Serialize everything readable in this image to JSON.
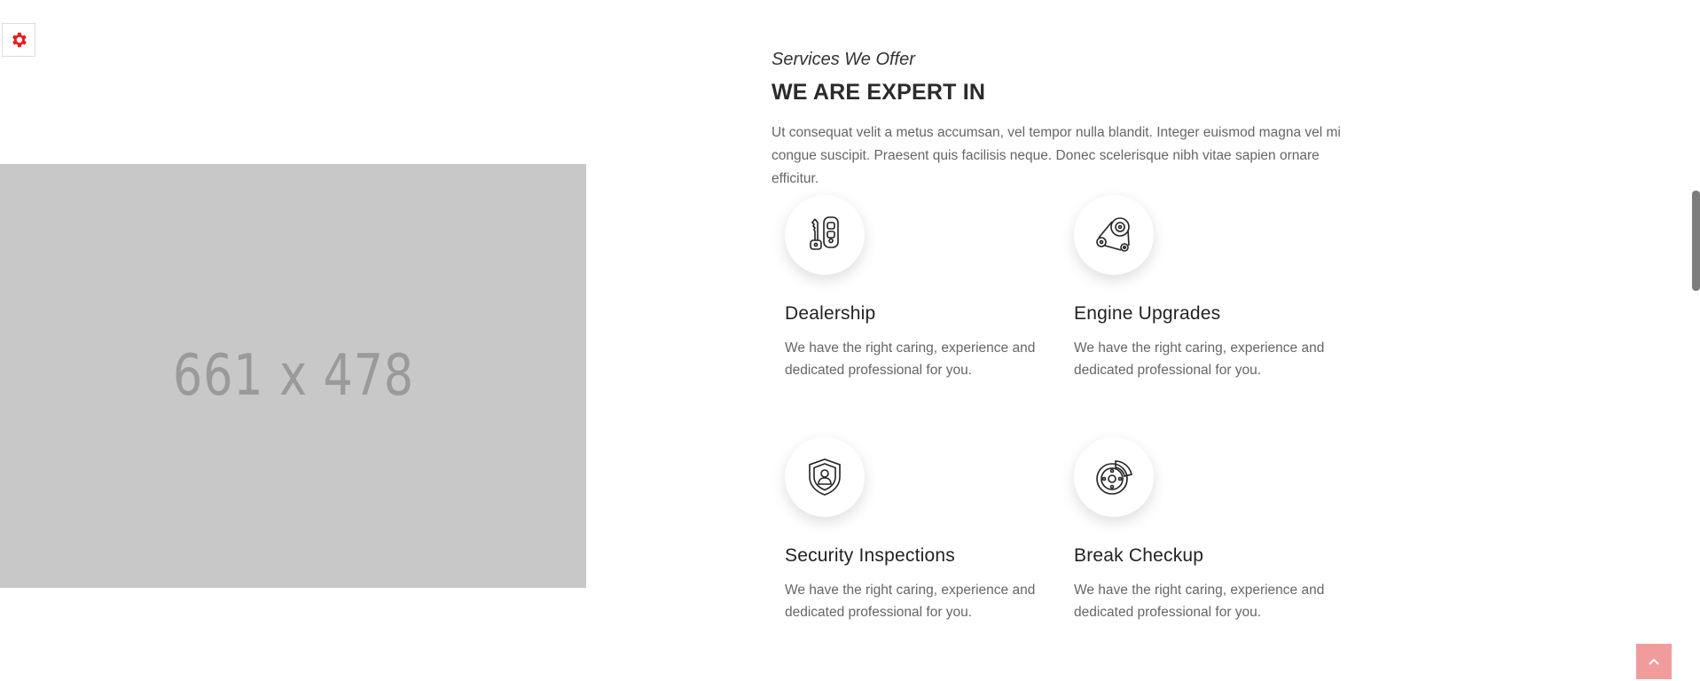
{
  "settings": {
    "icon": "gear-icon",
    "color": "#e02020"
  },
  "image_placeholder": {
    "label": "661 x 478"
  },
  "section": {
    "subtitle": "Services We Offer",
    "title": "WE ARE EXPERT IN",
    "intro": "Ut consequat velit a metus accumsan, vel tempor nulla blandit. Integer euismod magna vel mi congue suscipit. Praesent quis facilisis neque. Donec scelerisque nibh vitae sapien ornare efficitur."
  },
  "services": [
    {
      "icon": "car-key-icon",
      "title": "Dealership",
      "desc": "We have the right caring, experience and dedicated professional for you."
    },
    {
      "icon": "timing-belt-icon",
      "title": "Engine Upgrades",
      "desc": "We have the right caring, experience and dedicated professional for you."
    },
    {
      "icon": "shield-person-icon",
      "title": "Security Inspections",
      "desc": "We have the right caring, experience and dedicated professional for you."
    },
    {
      "icon": "brake-disc-icon",
      "title": "Break Checkup",
      "desc": "We have the right caring, experience and dedicated professional for you."
    }
  ],
  "back_to_top": {
    "icon": "chevron-up-icon",
    "color": "#f19c9c"
  }
}
